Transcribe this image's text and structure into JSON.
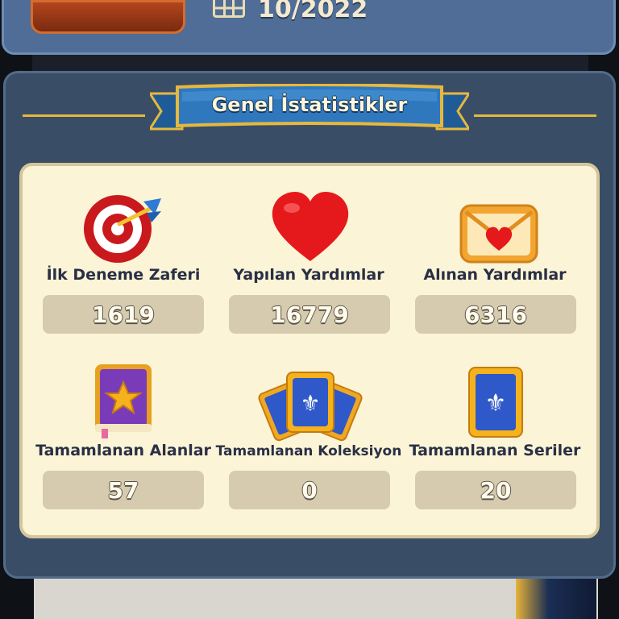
{
  "profile": {
    "join_date": "10/2022"
  },
  "panel": {
    "title": "Genel İstatistikler"
  },
  "stats": [
    {
      "label": "İlk Deneme Zaferi",
      "value": "1619",
      "icon": "target-icon"
    },
    {
      "label": "Yapılan Yardımlar",
      "value": "16779",
      "icon": "heart-icon"
    },
    {
      "label": "Alınan Yardımlar",
      "value": "6316",
      "icon": "envelope-heart-icon"
    },
    {
      "label": "Tamamlanan Alanlar",
      "value": "57",
      "icon": "star-book-icon"
    },
    {
      "label": "Tamamlanan Koleksiyon",
      "value": "0",
      "icon": "card-fan-icon"
    },
    {
      "label": "Tamamlanan Seriler",
      "value": "20",
      "icon": "card-icon"
    }
  ],
  "colors": {
    "panel_bg": "#3a4d66",
    "inner_bg": "#fbf4d6",
    "banner_blue": "#2e73b8",
    "gold": "#e6b83e"
  }
}
